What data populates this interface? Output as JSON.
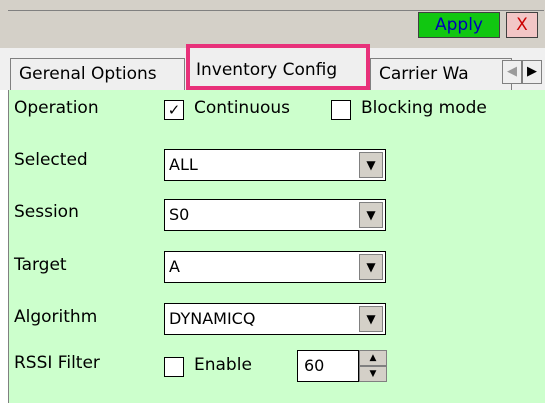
{
  "toolbar": {
    "apply_label": "Apply",
    "close_label": "X"
  },
  "tabs": [
    {
      "label": "Gerenal Options"
    },
    {
      "label": "Inventory Config"
    },
    {
      "label": "Carrier Wa"
    }
  ],
  "tab_scroll": {
    "left_icon": "◀",
    "right_icon": "▶"
  },
  "form": {
    "operation": {
      "label": "Operation",
      "continuous_label": "Continuous",
      "continuous_checked": true,
      "blocking_label": "Blocking mode",
      "blocking_checked": false
    },
    "selected": {
      "label": "Selected",
      "value": "ALL"
    },
    "session": {
      "label": "Session",
      "value": "S0"
    },
    "target": {
      "label": "Target",
      "value": "A"
    },
    "algorithm": {
      "label": "Algorithm",
      "value": "DYNAMICQ"
    },
    "rssi": {
      "label": "RSSI Filter",
      "enable_label": "Enable",
      "enable_checked": false,
      "value": "60"
    }
  },
  "colors": {
    "apply_bg": "#11c711",
    "close_bg": "#f2c6c6",
    "active_tab_border": "#e8317a",
    "content_bg": "#ccffcc"
  },
  "icons": {
    "checkmark": "✓",
    "dropdown": "▼",
    "spin_up": "▲",
    "spin_down": "▼"
  }
}
